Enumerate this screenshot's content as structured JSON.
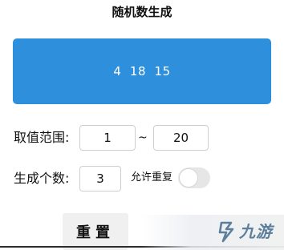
{
  "header": {
    "title": "随机数生成"
  },
  "result": {
    "numbers_text": "4  18  15"
  },
  "range": {
    "label": "取值范围:",
    "min_value": "1",
    "separator": "~",
    "max_value": "20"
  },
  "count": {
    "label": "生成个数:",
    "value": "3"
  },
  "allow_repeat": {
    "label": "允许重复",
    "enabled": false
  },
  "actions": {
    "reset_label": "重置"
  },
  "watermark": {
    "text": "九游",
    "logo": "jiuyou-logo-icon"
  },
  "colors": {
    "accent": "#2e8fdc",
    "toggle_off": "#e6e6e6",
    "button_bg": "#f0f0f0"
  }
}
